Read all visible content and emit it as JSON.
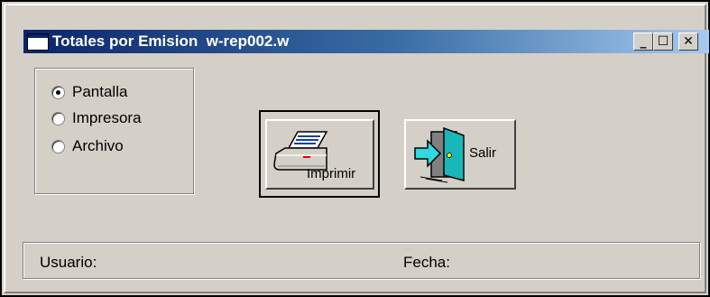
{
  "window": {
    "title": "Totales por Emision  w-rep002.w",
    "controls": {
      "minimize": "_",
      "maximize": "☐",
      "close": "✕"
    }
  },
  "output_options": [
    {
      "label": "Pantalla",
      "checked": true
    },
    {
      "label": "Impresora",
      "checked": false
    },
    {
      "label": "Archivo",
      "checked": false
    }
  ],
  "buttons": {
    "print_label": "Imprimir",
    "exit_label": "Salir"
  },
  "status": {
    "user_label": "Usuario:",
    "user_value": "",
    "date_label": "Fecha:",
    "date_value": ""
  },
  "icons": {
    "window": "application-window-icon",
    "print": "printer-icon",
    "exit": "exit-door-icon"
  }
}
